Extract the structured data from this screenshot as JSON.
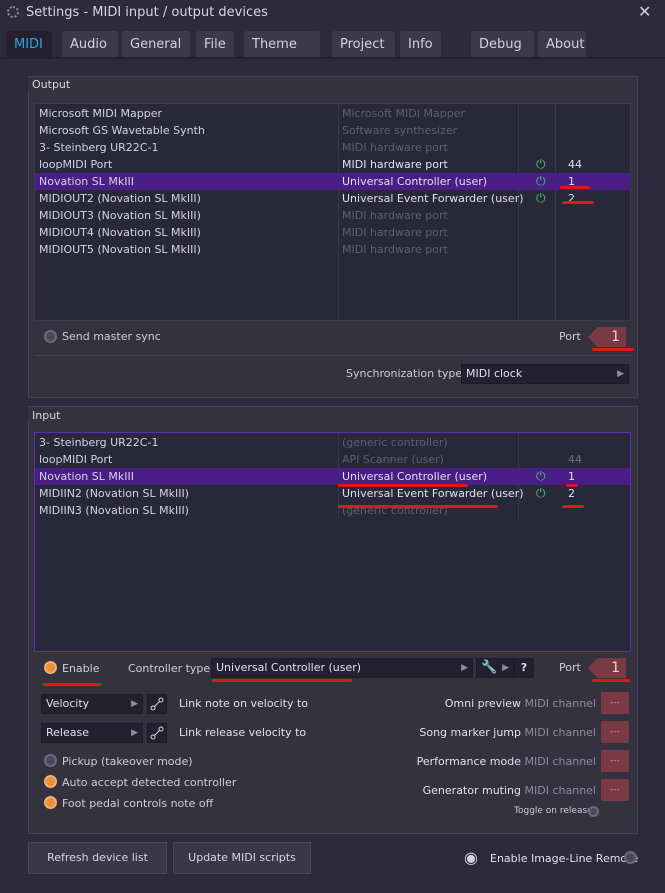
{
  "window": {
    "title": "Settings - MIDI input / output devices",
    "close": "✕"
  },
  "tabs": [
    "MIDI",
    "Audio",
    "General",
    "File",
    "Theme",
    "Project",
    "Info",
    "Debug",
    "About"
  ],
  "output": {
    "title": "Output",
    "rows": [
      {
        "name": "Microsoft MIDI Mapper",
        "type": "Microsoft MIDI Mapper",
        "dim": true,
        "power": false,
        "port": ""
      },
      {
        "name": "Microsoft GS Wavetable Synth",
        "type": "Software synthesizer",
        "dim": true,
        "power": false,
        "port": ""
      },
      {
        "name": "3- Steinberg UR22C-1",
        "type": "MIDI hardware port",
        "dim": true,
        "power": false,
        "port": ""
      },
      {
        "name": "loopMIDI Port",
        "type": "MIDI hardware port",
        "dim": false,
        "power": true,
        "port": "44"
      },
      {
        "name": "Novation SL MkIII",
        "type": "Universal Controller (user)",
        "dim": false,
        "power": true,
        "port": "1",
        "sel": true
      },
      {
        "name": "MIDIOUT2 (Novation SL MkIII)",
        "type": "Universal Event Forwarder (user)",
        "dim": false,
        "power": true,
        "port": "2"
      },
      {
        "name": "MIDIOUT3 (Novation SL MkIII)",
        "type": "MIDI hardware port",
        "dim": true,
        "power": false,
        "port": ""
      },
      {
        "name": "MIDIOUT4 (Novation SL MkIII)",
        "type": "MIDI hardware port",
        "dim": true,
        "power": false,
        "port": ""
      },
      {
        "name": "MIDIOUT5 (Novation SL MkIII)",
        "type": "MIDI hardware port",
        "dim": true,
        "power": false,
        "port": ""
      }
    ],
    "send_master_sync": "Send master sync",
    "port_label": "Port",
    "port_value": "1",
    "sync_label": "Synchronization type",
    "sync_value": "MIDI clock"
  },
  "input": {
    "title": "Input",
    "rows": [
      {
        "name": "3- Steinberg UR22C-1",
        "type": "(generic controller)",
        "dim": true,
        "power": false,
        "port": ""
      },
      {
        "name": "loopMIDI Port",
        "type": "API Scanner (user)",
        "dim": true,
        "power": false,
        "port": "44",
        "portdim": true
      },
      {
        "name": "Novation SL MkIII",
        "type": "Universal Controller (user)",
        "dim": false,
        "power": true,
        "port": "1",
        "sel": true
      },
      {
        "name": "MIDIIN2 (Novation SL MkIII)",
        "type": "Universal Event Forwarder (user)",
        "dim": false,
        "power": true,
        "port": "2"
      },
      {
        "name": "MIDIIN3 (Novation SL MkIII)",
        "type": "(generic controller)",
        "dim": true,
        "power": false,
        "port": ""
      }
    ],
    "enable": "Enable",
    "controller_type_label": "Controller type",
    "controller_type_value": "Universal Controller (user)",
    "help": "?",
    "port_label": "Port",
    "port_value": "1",
    "velocity_dd": "Velocity",
    "link_velocity": "Link note on velocity to",
    "release_dd": "Release",
    "link_release": "Link release velocity to",
    "pickup": "Pickup (takeover mode)",
    "auto_accept": "Auto accept detected controller",
    "foot_pedal": "Foot pedal controls note off",
    "omni": "Omni preview",
    "song_marker": "Song marker jump",
    "performance": "Performance mode",
    "generator": "Generator muting",
    "midi_channel": "MIDI channel",
    "chip": "---",
    "toggle_release": "Toggle on release"
  },
  "footer": {
    "refresh": "Refresh device list",
    "update": "Update MIDI scripts",
    "remote": "Enable Image-Line Remote"
  },
  "power_glyph": "⏻",
  "colors": {
    "accent": "#2fa0e8",
    "selection": "#4b1d86",
    "power": "#3ec86a",
    "port": "#7a3a44",
    "radio_on": "#e8923a",
    "annotation": "#e0161a"
  }
}
